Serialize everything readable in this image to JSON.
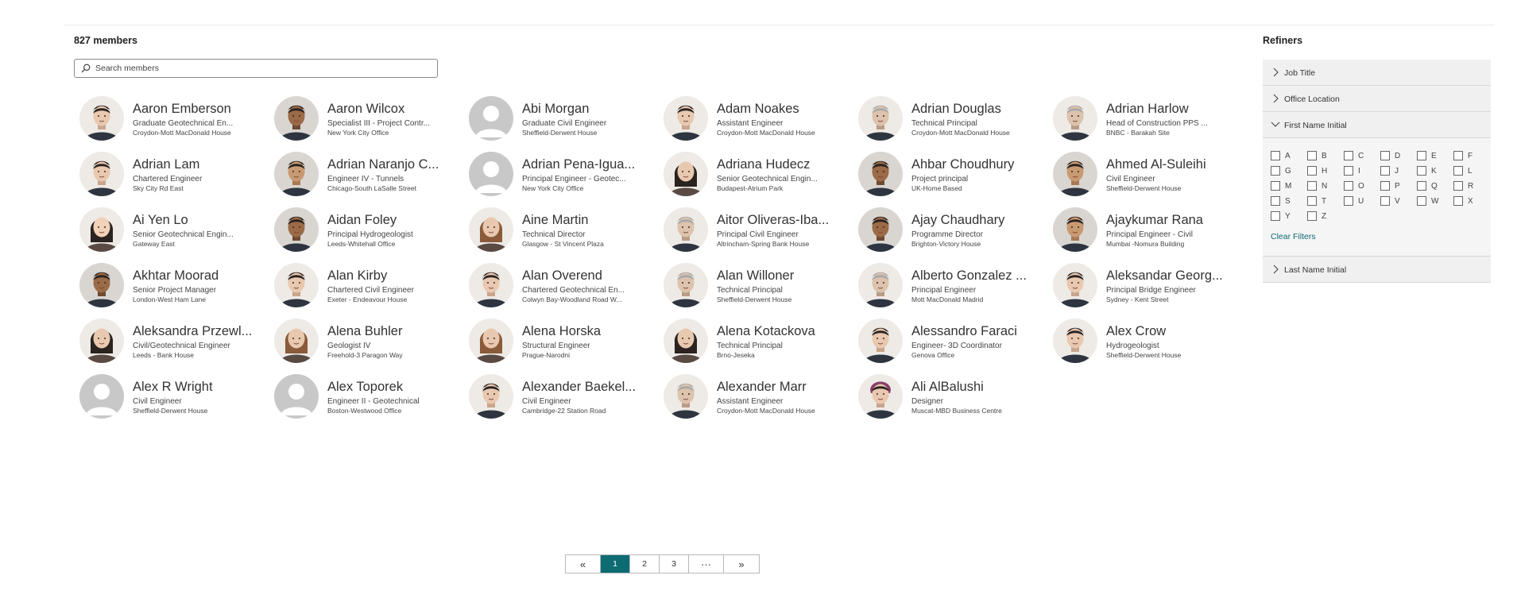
{
  "header": {
    "member_count": "827 members"
  },
  "search": {
    "placeholder": "Search members"
  },
  "members": [
    {
      "name": "Aaron Emberson",
      "title": "Graduate Geotechnical En...",
      "office": "Croydon-Mott MacDonald House",
      "photo": "man-light-1"
    },
    {
      "name": "Aaron Wilcox",
      "title": "Specialist III - Project Contr...",
      "office": "New York City Office",
      "photo": "man-dark-1"
    },
    {
      "name": "Abi Morgan",
      "title": "Graduate Civil Engineer",
      "office": "Sheffield-Derwent House",
      "photo": "placeholder"
    },
    {
      "name": "Adam Noakes",
      "title": "Assistant Engineer",
      "office": "Croydon-Mott MacDonald House",
      "photo": "man-light-2"
    },
    {
      "name": "Adrian Douglas",
      "title": "Technical Principal",
      "office": "Croydon-Mott MacDonald House",
      "photo": "man-grey-1"
    },
    {
      "name": "Adrian Harlow",
      "title": "Head of Construction PPS ...",
      "office": "BNBC - Barakah Site",
      "photo": "man-grey-2"
    },
    {
      "name": "Adrian Lam",
      "title": "Chartered Engineer",
      "office": "Sky City Rd East",
      "photo": "man-light-3"
    },
    {
      "name": "Adrian Naranjo C...",
      "title": "Engineer IV - Tunnels",
      "office": "Chicago-South LaSalle Street",
      "photo": "man-tan-1"
    },
    {
      "name": "Adrian Pena-Igua...",
      "title": "Principal Engineer - Geotec...",
      "office": "New York City Office",
      "photo": "placeholder"
    },
    {
      "name": "Adriana Hudecz",
      "title": "Senior Geotechnical Engin...",
      "office": "Budapest-Atrium Park",
      "photo": "woman-dark-hair-1"
    },
    {
      "name": "Ahbar Choudhury",
      "title": "Project principal",
      "office": "UK-Home Based",
      "photo": "man-dark-2"
    },
    {
      "name": "Ahmed Al-Suleihi",
      "title": "Civil Engineer",
      "office": "Sheffield-Derwent House",
      "photo": "man-tan-2"
    },
    {
      "name": "Ai Yen Lo",
      "title": "Senior Geotechnical Engin...",
      "office": "Gateway East",
      "photo": "woman-asian-1"
    },
    {
      "name": "Aidan Foley",
      "title": "Principal Hydrogeologist",
      "office": "Leeds-Whitehall Office",
      "photo": "man-dark-3"
    },
    {
      "name": "Aine Martin",
      "title": "Technical Director",
      "office": "Glasgow - St Vincent Plaza",
      "photo": "woman-light-1"
    },
    {
      "name": "Aitor Oliveras-Iba...",
      "title": "Principal Civil Engineer",
      "office": "Altrincham-Spring Bank House",
      "photo": "man-grey-3"
    },
    {
      "name": "Ajay Chaudhary",
      "title": "Programme Director",
      "office": "Brighton-Victory House",
      "photo": "man-dark-4"
    },
    {
      "name": "Ajaykumar Rana",
      "title": "Principal Engineer - Civil",
      "office": "Mumbai -Nomura Building",
      "photo": "man-tan-3"
    },
    {
      "name": "Akhtar Moorad",
      "title": "Senior Project Manager",
      "office": "London-West Ham Lane",
      "photo": "man-dark-5"
    },
    {
      "name": "Alan Kirby",
      "title": "Chartered Civil Engineer",
      "office": "Exeter - Endeavour House",
      "photo": "man-light-4"
    },
    {
      "name": "Alan Overend",
      "title": "Chartered Geotechnical En...",
      "office": "Colwyn Bay-Woodland Road W...",
      "photo": "man-light-5"
    },
    {
      "name": "Alan Willoner",
      "title": "Technical Principal",
      "office": "Sheffield-Derwent House",
      "photo": "man-grey-4"
    },
    {
      "name": "Alberto Gonzalez ...",
      "title": "Principal Engineer",
      "office": "Mott MacDonald Madrid",
      "photo": "man-grey-5"
    },
    {
      "name": "Aleksandar Georg...",
      "title": "Principal Bridge Engineer",
      "office": "Sydney - Kent Street",
      "photo": "man-light-6"
    },
    {
      "name": "Aleksandra Przewl...",
      "title": "Civil/Geotechnical Engineer",
      "office": "Leeds - Bank House",
      "photo": "woman-dark-hair-2"
    },
    {
      "name": "Alena Buhler",
      "title": "Geologist IV",
      "office": "Freehold-3 Paragon Way",
      "photo": "woman-light-2"
    },
    {
      "name": "Alena Horska",
      "title": "Structural Engineer",
      "office": "Prague-Narodni",
      "photo": "woman-light-3"
    },
    {
      "name": "Alena Kotackova",
      "title": "Technical Principal",
      "office": "Brno-Jeseka",
      "photo": "woman-dark-hair-3"
    },
    {
      "name": "Alessandro Faraci",
      "title": "Engineer- 3D Coordinator",
      "office": "Genova Office",
      "photo": "man-light-7"
    },
    {
      "name": "Alex Crow",
      "title": "Hydrogeologist",
      "office": "Sheffield-Derwent House",
      "photo": "man-light-8"
    },
    {
      "name": "Alex R Wright",
      "title": "Civil Engineer",
      "office": "Sheffield-Derwent House",
      "photo": "placeholder"
    },
    {
      "name": "Alex Toporek",
      "title": "Engineer II - Geotechnical",
      "office": "Boston-Westwood Office",
      "photo": "placeholder"
    },
    {
      "name": "Alexander Baekel...",
      "title": "Civil Engineer",
      "office": "Cambridge-22 Station Road",
      "photo": "man-light-9"
    },
    {
      "name": "Alexander Marr",
      "title": "Assistant Engineer",
      "office": "Croydon-Mott MacDonald House",
      "photo": "man-grey-6"
    },
    {
      "name": "Ali AlBalushi",
      "title": "Designer",
      "office": "Muscat-MBD Business Centre",
      "photo": "man-headwrap-1"
    }
  ],
  "pagination": {
    "first_label": "«",
    "pages": [
      "1",
      "2",
      "3"
    ],
    "current": "1",
    "ellipsis": "···",
    "last_label": "»"
  },
  "refiners": {
    "title": "Refiners",
    "sections": [
      {
        "label": "Job Title",
        "expanded": false
      },
      {
        "label": "Office Location",
        "expanded": false
      },
      {
        "label": "First Name Initial",
        "expanded": true
      },
      {
        "label": "Last Name Initial",
        "expanded": false
      }
    ],
    "initials": [
      "A",
      "B",
      "C",
      "D",
      "E",
      "F",
      "G",
      "H",
      "I",
      "J",
      "K",
      "L",
      "M",
      "N",
      "O",
      "P",
      "Q",
      "R",
      "S",
      "T",
      "U",
      "V",
      "W",
      "X",
      "Y",
      "Z"
    ],
    "clear_label": "Clear Filters"
  },
  "colors": {
    "accent": "#0d6b72",
    "placeholder_avatar": "#c8c8c8"
  }
}
